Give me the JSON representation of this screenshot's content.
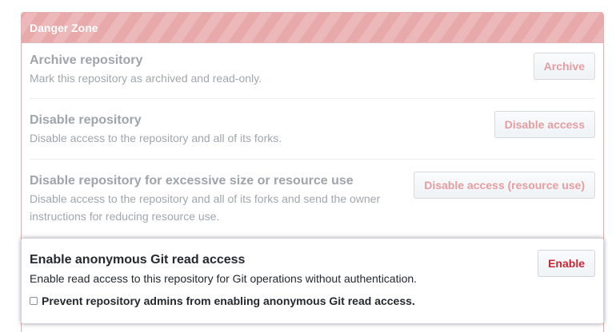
{
  "panel": {
    "header_title": "Danger Zone"
  },
  "rows": [
    {
      "title": "Archive repository",
      "description": "Mark this repository as archived and read-only.",
      "button_label": "Archive"
    },
    {
      "title": "Disable repository",
      "description": "Disable access to the repository and all of its forks.",
      "button_label": "Disable access"
    },
    {
      "title": "Disable repository for excessive size or resource use",
      "description_line1": "Disable access to the repository and all of its forks and send the owner",
      "description_line2": "instructions for reducing resource use.",
      "button_label": "Disable access (resource use)"
    }
  ],
  "anonymous_access": {
    "title": "Enable anonymous Git read access",
    "description": "Enable read access to this repository for Git operations without authentication.",
    "button_label": "Enable",
    "checkbox_label": "Prevent repository admins from enabling anonymous Git read access.",
    "checkbox_checked": false
  },
  "colors": {
    "danger_header": "#e8a9ab",
    "danger_button_text": "#cb2431",
    "muted_button_text": "#e59da1",
    "muted_text": "#a1a6ab"
  }
}
